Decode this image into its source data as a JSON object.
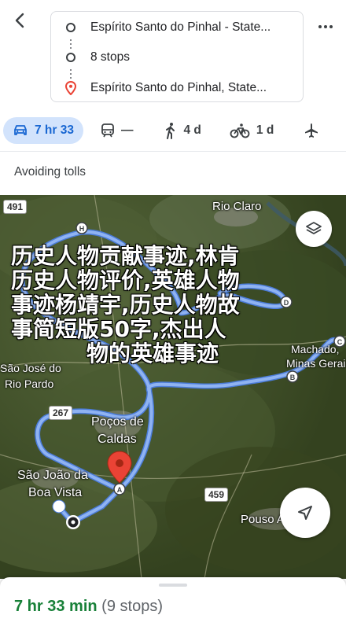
{
  "header": {
    "origin": "Espírito Santo do Pinhal - State...",
    "stops": "8 stops",
    "destination": "Espírito Santo do Pinhal, State..."
  },
  "modes": [
    {
      "icon": "car-icon",
      "label": "7 hr 33",
      "active": true
    },
    {
      "icon": "train-icon",
      "label": "—",
      "active": false
    },
    {
      "icon": "walk-icon",
      "label": "4 d",
      "active": false
    },
    {
      "icon": "bike-icon",
      "label": "1 d",
      "active": false
    },
    {
      "icon": "flight-icon",
      "label": "",
      "active": false
    }
  ],
  "options": {
    "avoid_label": "Avoiding tolls"
  },
  "map": {
    "labels": {
      "rio_claro": "Rio Claro",
      "sao_jose": "São José do",
      "rio_pardo": "Rio Pardo",
      "pocos_1": "Poços de",
      "pocos_2": "Caldas",
      "sao_joao_1": "São João da",
      "sao_joao_2": "Boa Vista",
      "pouso": "Pouso Alegre",
      "machado": "Machado,",
      "minas": "Minas Gerais"
    },
    "roads": {
      "r491": "491",
      "r267": "267",
      "r459": "459"
    },
    "stop_letters": [
      "A",
      "B",
      "C",
      "D",
      "H"
    ],
    "overlay_lines": [
      "历史人物贡献事迹,林肯",
      "历史人物评价,英雄人物",
      "事迹杨靖宇,历史人物故",
      "事简短版50字,杰出人",
      "物的英雄事迹"
    ],
    "colors": {
      "route": "#7fa8ef",
      "route_stroke": "#4a7bd8",
      "pin": "#ea4335"
    }
  },
  "sheet": {
    "time": "7 hr 33 min",
    "stops": "(9 stops)"
  }
}
